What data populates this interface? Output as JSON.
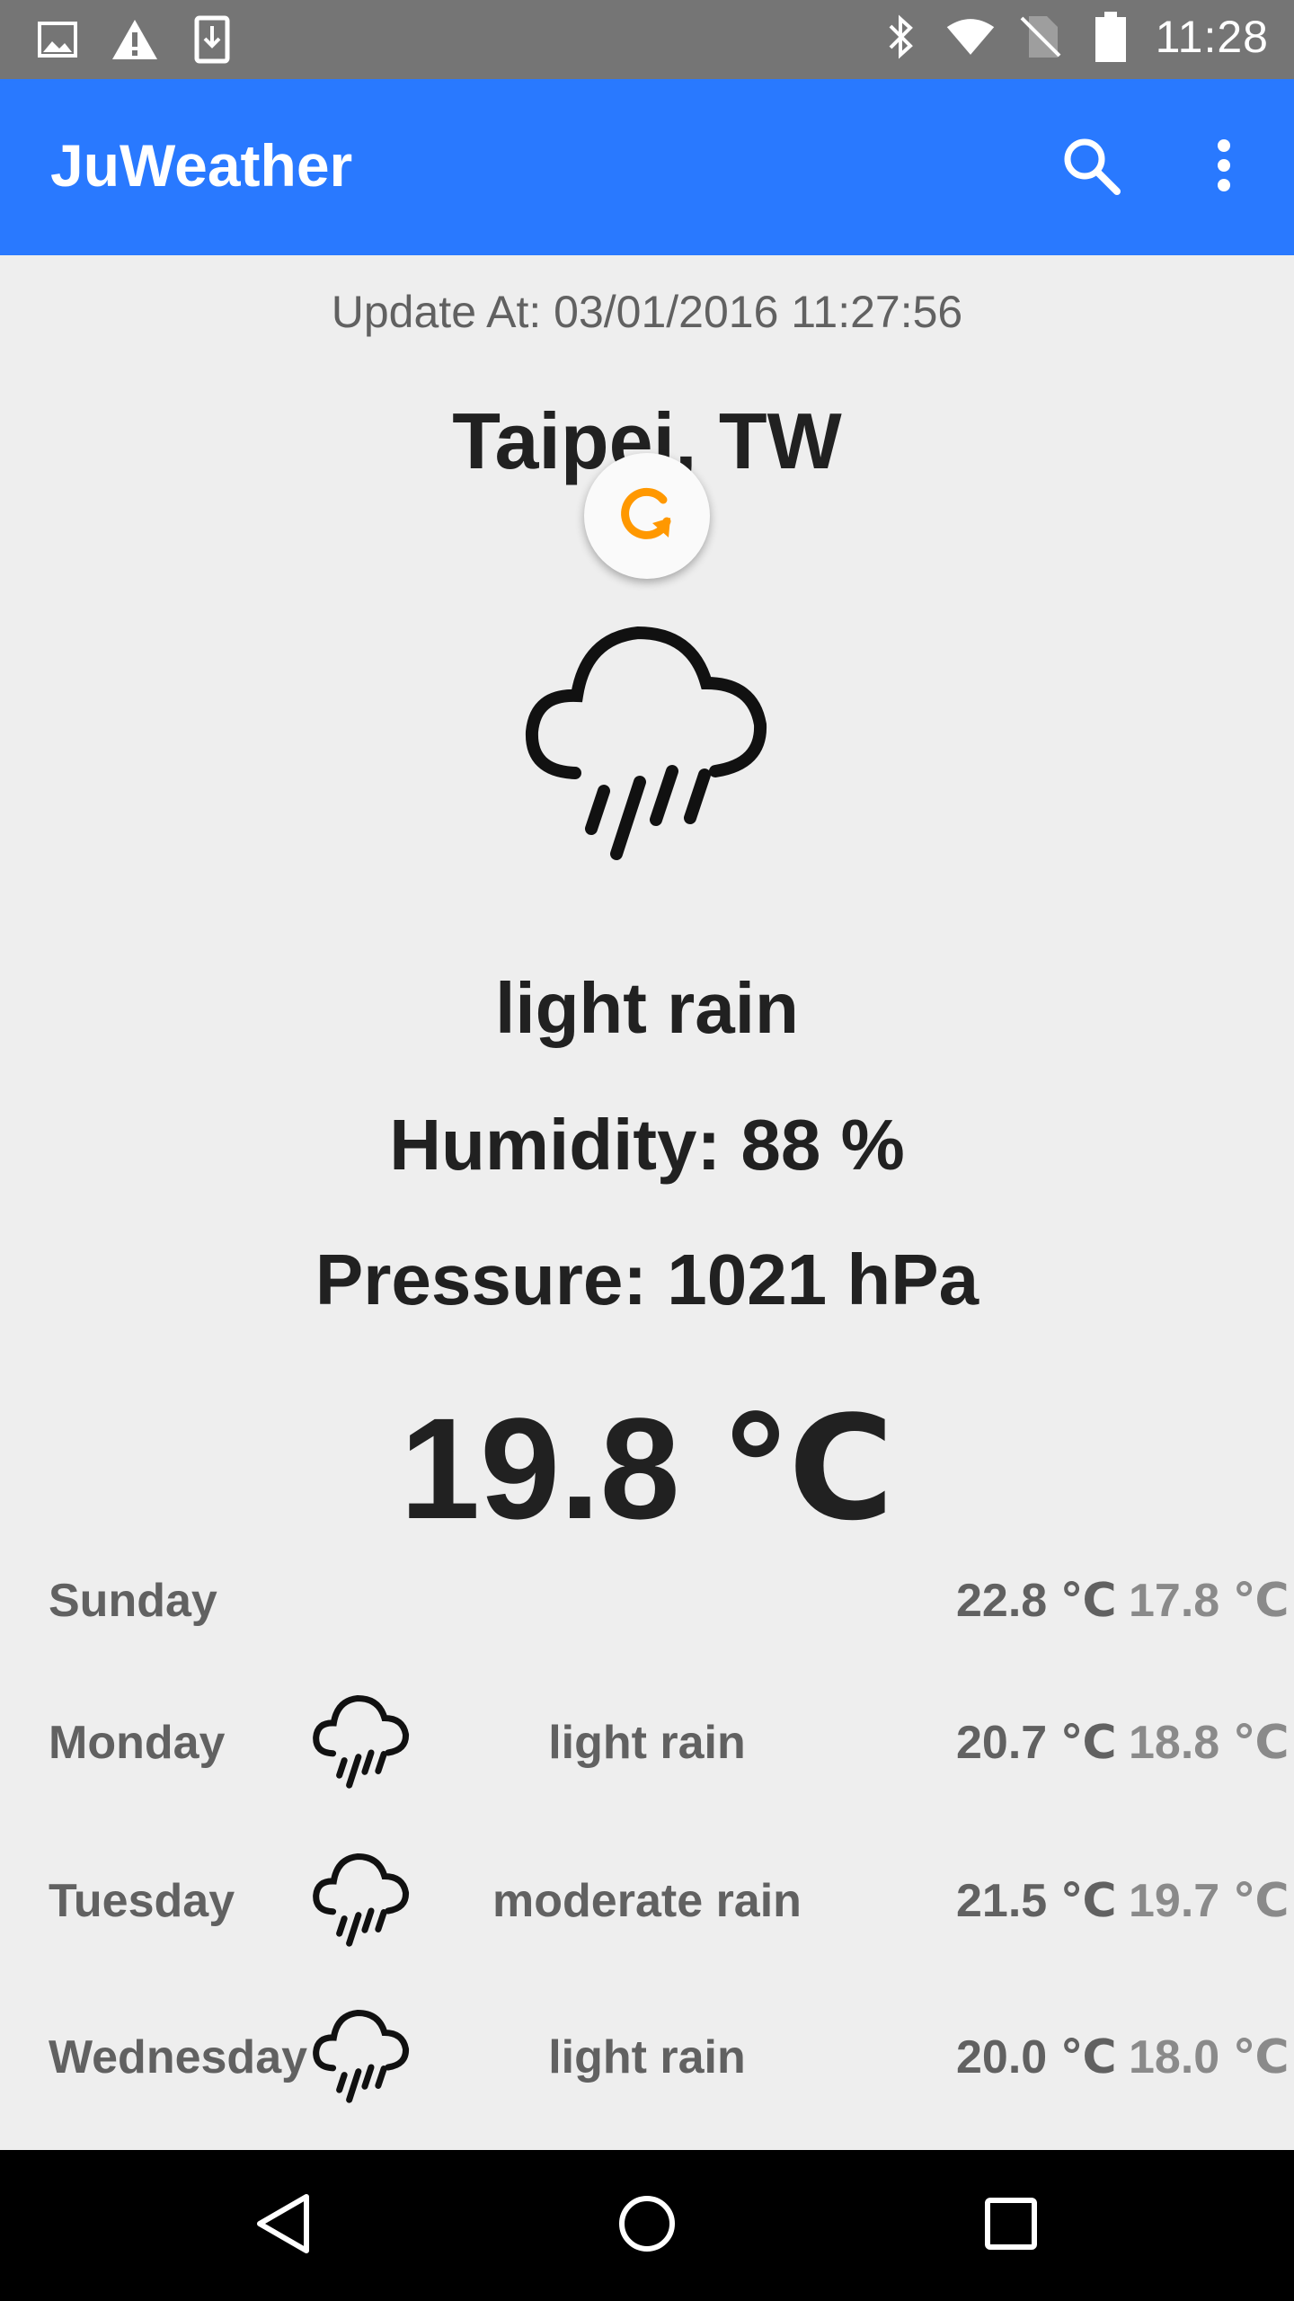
{
  "status_bar": {
    "time": "11:28",
    "icons_left": [
      "image-icon",
      "warning-icon",
      "download-icon"
    ],
    "icons_right": [
      "bluetooth-icon",
      "wifi-icon",
      "no-sim-icon",
      "battery-icon"
    ]
  },
  "app_bar": {
    "title": "JuWeather",
    "color": "#2979ff",
    "actions": [
      "search-icon",
      "more-vert-icon"
    ]
  },
  "current": {
    "update_at": "Update At: 03/01/2016 11:27:56",
    "city": "Taipei, TW",
    "icon": "rain-cloud-icon",
    "condition": "light rain",
    "humidity": "Humidity: 88 %",
    "pressure": "Pressure: 1021 hPa",
    "temperature": "19.8 ℃"
  },
  "refresh": {
    "icon": "refresh-icon",
    "accent": "#ff9800"
  },
  "forecast": [
    {
      "day": "Sunday",
      "icon": "",
      "condition": "",
      "high": "22.8 ℃",
      "low": "17.8 ℃"
    },
    {
      "day": "Monday",
      "icon": "rain-cloud-icon",
      "condition": "light rain",
      "high": "20.7 ℃",
      "low": "18.8 ℃"
    },
    {
      "day": "Tuesday",
      "icon": "rain-cloud-icon",
      "condition": "moderate rain",
      "high": "21.5 ℃",
      "low": "19.7 ℃"
    },
    {
      "day": "Wednesday",
      "icon": "rain-cloud-icon",
      "condition": "light rain",
      "high": "20.0 ℃",
      "low": "18.0 ℃"
    }
  ],
  "nav_bar": [
    "back-icon",
    "home-icon",
    "recents-icon"
  ]
}
